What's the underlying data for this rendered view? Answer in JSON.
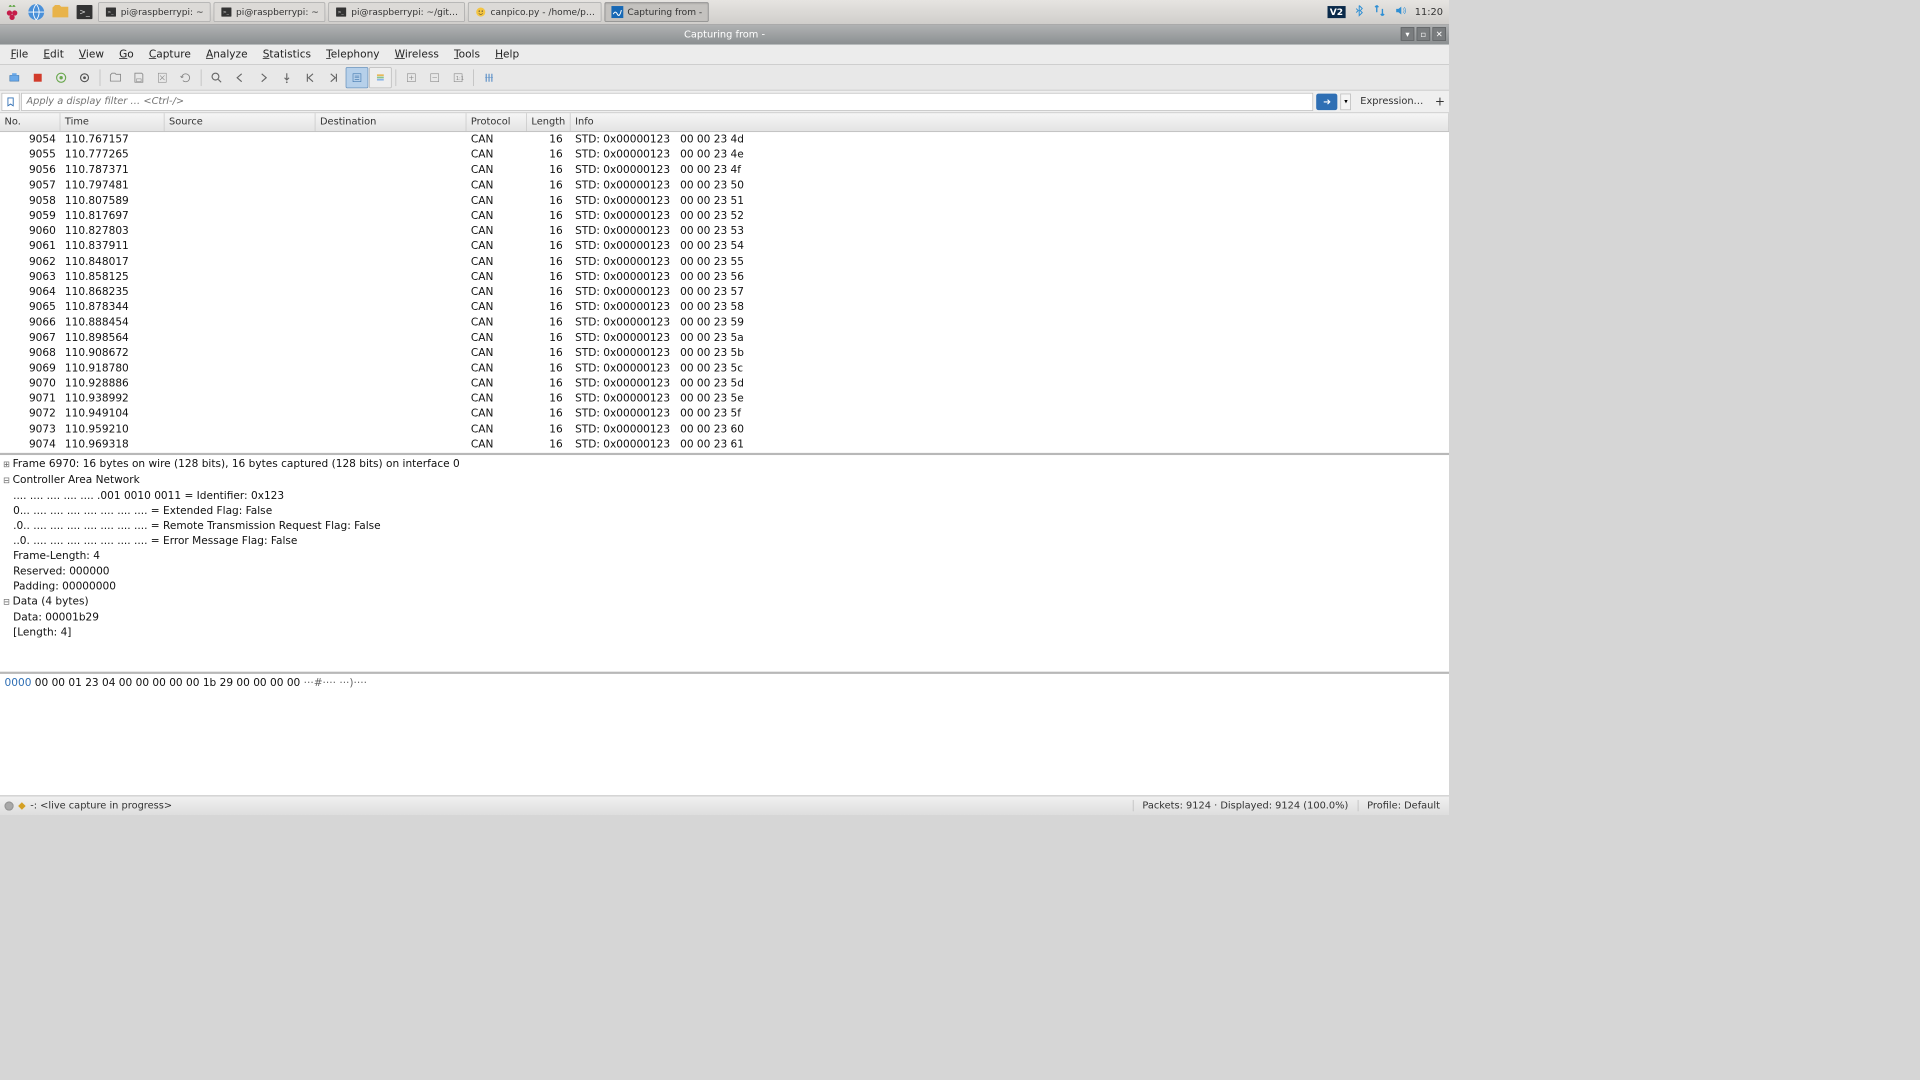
{
  "taskbar": {
    "tasks": [
      {
        "icon": "term",
        "label": "pi@raspberrypi: ~"
      },
      {
        "icon": "term",
        "label": "pi@raspberrypi: ~"
      },
      {
        "icon": "term",
        "label": "pi@raspberrypi: ~/git…"
      },
      {
        "icon": "edit",
        "label": "canpico.py - /home/p…"
      },
      {
        "icon": "ws",
        "label": "Capturing from -",
        "active": true
      }
    ],
    "clock": "11:20"
  },
  "window": {
    "title": "Capturing from -"
  },
  "menu": [
    "File",
    "Edit",
    "View",
    "Go",
    "Capture",
    "Analyze",
    "Statistics",
    "Telephony",
    "Wireless",
    "Tools",
    "Help"
  ],
  "filter": {
    "placeholder": "Apply a display filter … <Ctrl-/>",
    "expr_btn": "Expression…"
  },
  "columns": [
    "No.",
    "Time",
    "Source",
    "Destination",
    "Protocol",
    "Length",
    "Info"
  ],
  "packets": [
    {
      "no": "9054",
      "time": "110.767157",
      "src": "",
      "dst": "",
      "proto": "CAN",
      "len": "16",
      "info": "STD: 0x00000123   00 00 23 4d"
    },
    {
      "no": "9055",
      "time": "110.777265",
      "src": "",
      "dst": "",
      "proto": "CAN",
      "len": "16",
      "info": "STD: 0x00000123   00 00 23 4e"
    },
    {
      "no": "9056",
      "time": "110.787371",
      "src": "",
      "dst": "",
      "proto": "CAN",
      "len": "16",
      "info": "STD: 0x00000123   00 00 23 4f"
    },
    {
      "no": "9057",
      "time": "110.797481",
      "src": "",
      "dst": "",
      "proto": "CAN",
      "len": "16",
      "info": "STD: 0x00000123   00 00 23 50"
    },
    {
      "no": "9058",
      "time": "110.807589",
      "src": "",
      "dst": "",
      "proto": "CAN",
      "len": "16",
      "info": "STD: 0x00000123   00 00 23 51"
    },
    {
      "no": "9059",
      "time": "110.817697",
      "src": "",
      "dst": "",
      "proto": "CAN",
      "len": "16",
      "info": "STD: 0x00000123   00 00 23 52"
    },
    {
      "no": "9060",
      "time": "110.827803",
      "src": "",
      "dst": "",
      "proto": "CAN",
      "len": "16",
      "info": "STD: 0x00000123   00 00 23 53"
    },
    {
      "no": "9061",
      "time": "110.837911",
      "src": "",
      "dst": "",
      "proto": "CAN",
      "len": "16",
      "info": "STD: 0x00000123   00 00 23 54"
    },
    {
      "no": "9062",
      "time": "110.848017",
      "src": "",
      "dst": "",
      "proto": "CAN",
      "len": "16",
      "info": "STD: 0x00000123   00 00 23 55"
    },
    {
      "no": "9063",
      "time": "110.858125",
      "src": "",
      "dst": "",
      "proto": "CAN",
      "len": "16",
      "info": "STD: 0x00000123   00 00 23 56"
    },
    {
      "no": "9064",
      "time": "110.868235",
      "src": "",
      "dst": "",
      "proto": "CAN",
      "len": "16",
      "info": "STD: 0x00000123   00 00 23 57"
    },
    {
      "no": "9065",
      "time": "110.878344",
      "src": "",
      "dst": "",
      "proto": "CAN",
      "len": "16",
      "info": "STD: 0x00000123   00 00 23 58"
    },
    {
      "no": "9066",
      "time": "110.888454",
      "src": "",
      "dst": "",
      "proto": "CAN",
      "len": "16",
      "info": "STD: 0x00000123   00 00 23 59"
    },
    {
      "no": "9067",
      "time": "110.898564",
      "src": "",
      "dst": "",
      "proto": "CAN",
      "len": "16",
      "info": "STD: 0x00000123   00 00 23 5a"
    },
    {
      "no": "9068",
      "time": "110.908672",
      "src": "",
      "dst": "",
      "proto": "CAN",
      "len": "16",
      "info": "STD: 0x00000123   00 00 23 5b"
    },
    {
      "no": "9069",
      "time": "110.918780",
      "src": "",
      "dst": "",
      "proto": "CAN",
      "len": "16",
      "info": "STD: 0x00000123   00 00 23 5c"
    },
    {
      "no": "9070",
      "time": "110.928886",
      "src": "",
      "dst": "",
      "proto": "CAN",
      "len": "16",
      "info": "STD: 0x00000123   00 00 23 5d"
    },
    {
      "no": "9071",
      "time": "110.938992",
      "src": "",
      "dst": "",
      "proto": "CAN",
      "len": "16",
      "info": "STD: 0x00000123   00 00 23 5e"
    },
    {
      "no": "9072",
      "time": "110.949104",
      "src": "",
      "dst": "",
      "proto": "CAN",
      "len": "16",
      "info": "STD: 0x00000123   00 00 23 5f"
    },
    {
      "no": "9073",
      "time": "110.959210",
      "src": "",
      "dst": "",
      "proto": "CAN",
      "len": "16",
      "info": "STD: 0x00000123   00 00 23 60"
    },
    {
      "no": "9074",
      "time": "110.969318",
      "src": "",
      "dst": "",
      "proto": "CAN",
      "len": "16",
      "info": "STD: 0x00000123   00 00 23 61"
    }
  ],
  "details": [
    {
      "cls": "tree",
      "text": "Frame 6970: 16 bytes on wire (128 bits), 16 bytes captured (128 bits) on interface 0"
    },
    {
      "cls": "treeo",
      "text": "Controller Area Network"
    },
    {
      "cls": "",
      "text": "   .... .... .... .... .... .001 0010 0011 = Identifier: 0x123"
    },
    {
      "cls": "",
      "text": "   0... .... .... .... .... .... .... .... = Extended Flag: False"
    },
    {
      "cls": "",
      "text": "   .0.. .... .... .... .... .... .... .... = Remote Transmission Request Flag: False"
    },
    {
      "cls": "",
      "text": "   ..0. .... .... .... .... .... .... .... = Error Message Flag: False"
    },
    {
      "cls": "",
      "text": "   Frame-Length: 4"
    },
    {
      "cls": "",
      "text": "   Reserved: 000000"
    },
    {
      "cls": "",
      "text": "   Padding: 00000000"
    },
    {
      "cls": "treeo",
      "text": "Data (4 bytes)"
    },
    {
      "cls": "",
      "text": "   Data: 00001b29"
    },
    {
      "cls": "",
      "text": "   [Length: 4]"
    }
  ],
  "hex": {
    "offset": "0000",
    "bytes": "00 00 01 23 04 00 00 00  00 00 1b 29 00 00 00 00",
    "ascii": "   ···#···· ···)····"
  },
  "status": {
    "left": "-: <live capture in progress>",
    "center": "Packets: 9124 · Displayed: 9124 (100.0%)",
    "right": "Profile: Default"
  }
}
